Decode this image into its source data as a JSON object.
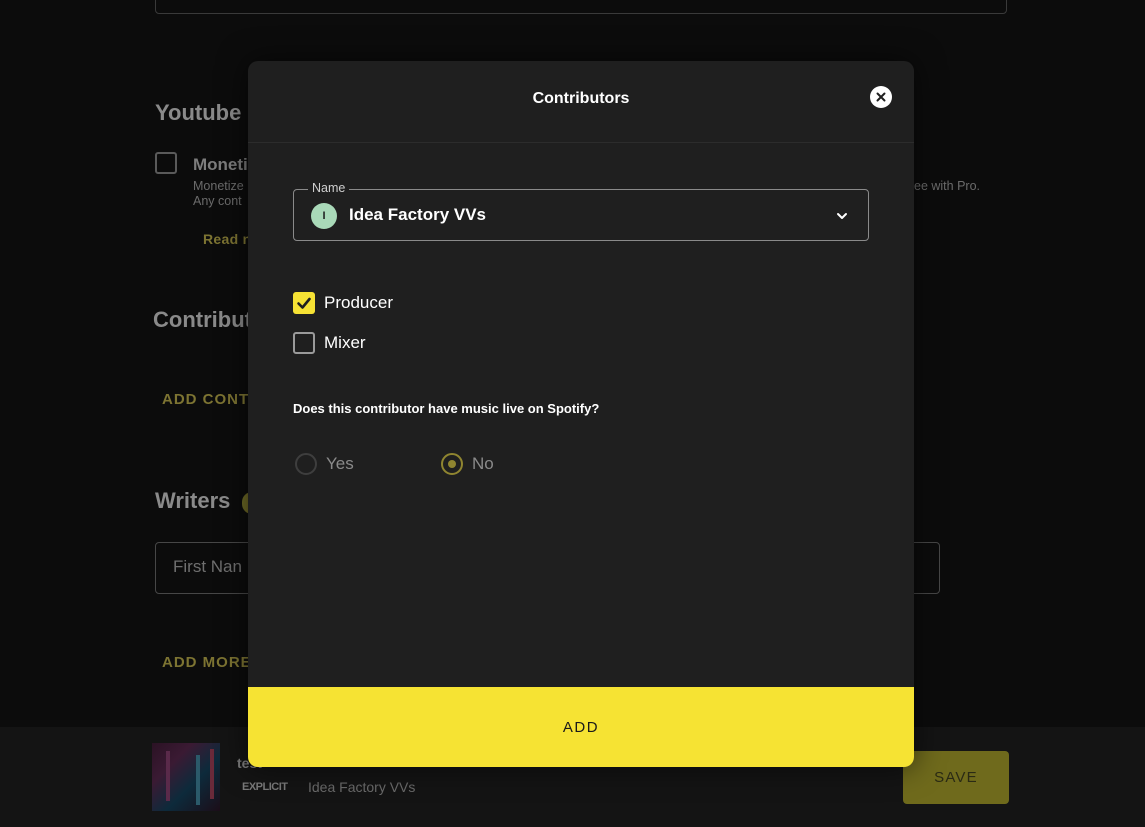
{
  "background": {
    "youtube_title": "Youtube",
    "monetize_label": "Moneti",
    "monetize_desc_line1": "Monetize",
    "monetize_desc_line2": "Any cont",
    "monetize_desc_right": "ee with Pro.",
    "read_more": "Read n",
    "contributors_title": "Contribut",
    "add_contributor": "ADD CONT",
    "writers_title": "Writers",
    "first_name_placeholder": "First Nan",
    "add_more": "ADD MORE"
  },
  "bottom_bar": {
    "track_title": "test",
    "explicit_tag": "EXPLICIT",
    "artist": "Idea Factory VVs",
    "save_label": "SAVE"
  },
  "modal": {
    "title": "Contributors",
    "name_field": {
      "legend": "Name",
      "avatar_letter": "I",
      "value": "Idea Factory VVs"
    },
    "roles": [
      {
        "label": "Producer",
        "checked": true
      },
      {
        "label": "Mixer",
        "checked": false
      }
    ],
    "question": "Does this contributor have music live on Spotify?",
    "options": [
      {
        "label": "Yes",
        "selected": false
      },
      {
        "label": "No",
        "selected": true
      }
    ],
    "add_label": "ADD"
  },
  "colors": {
    "accent_yellow": "#f6e333",
    "modal_bg": "#1f1f1f",
    "avatar_green": "#a9d9b8"
  }
}
